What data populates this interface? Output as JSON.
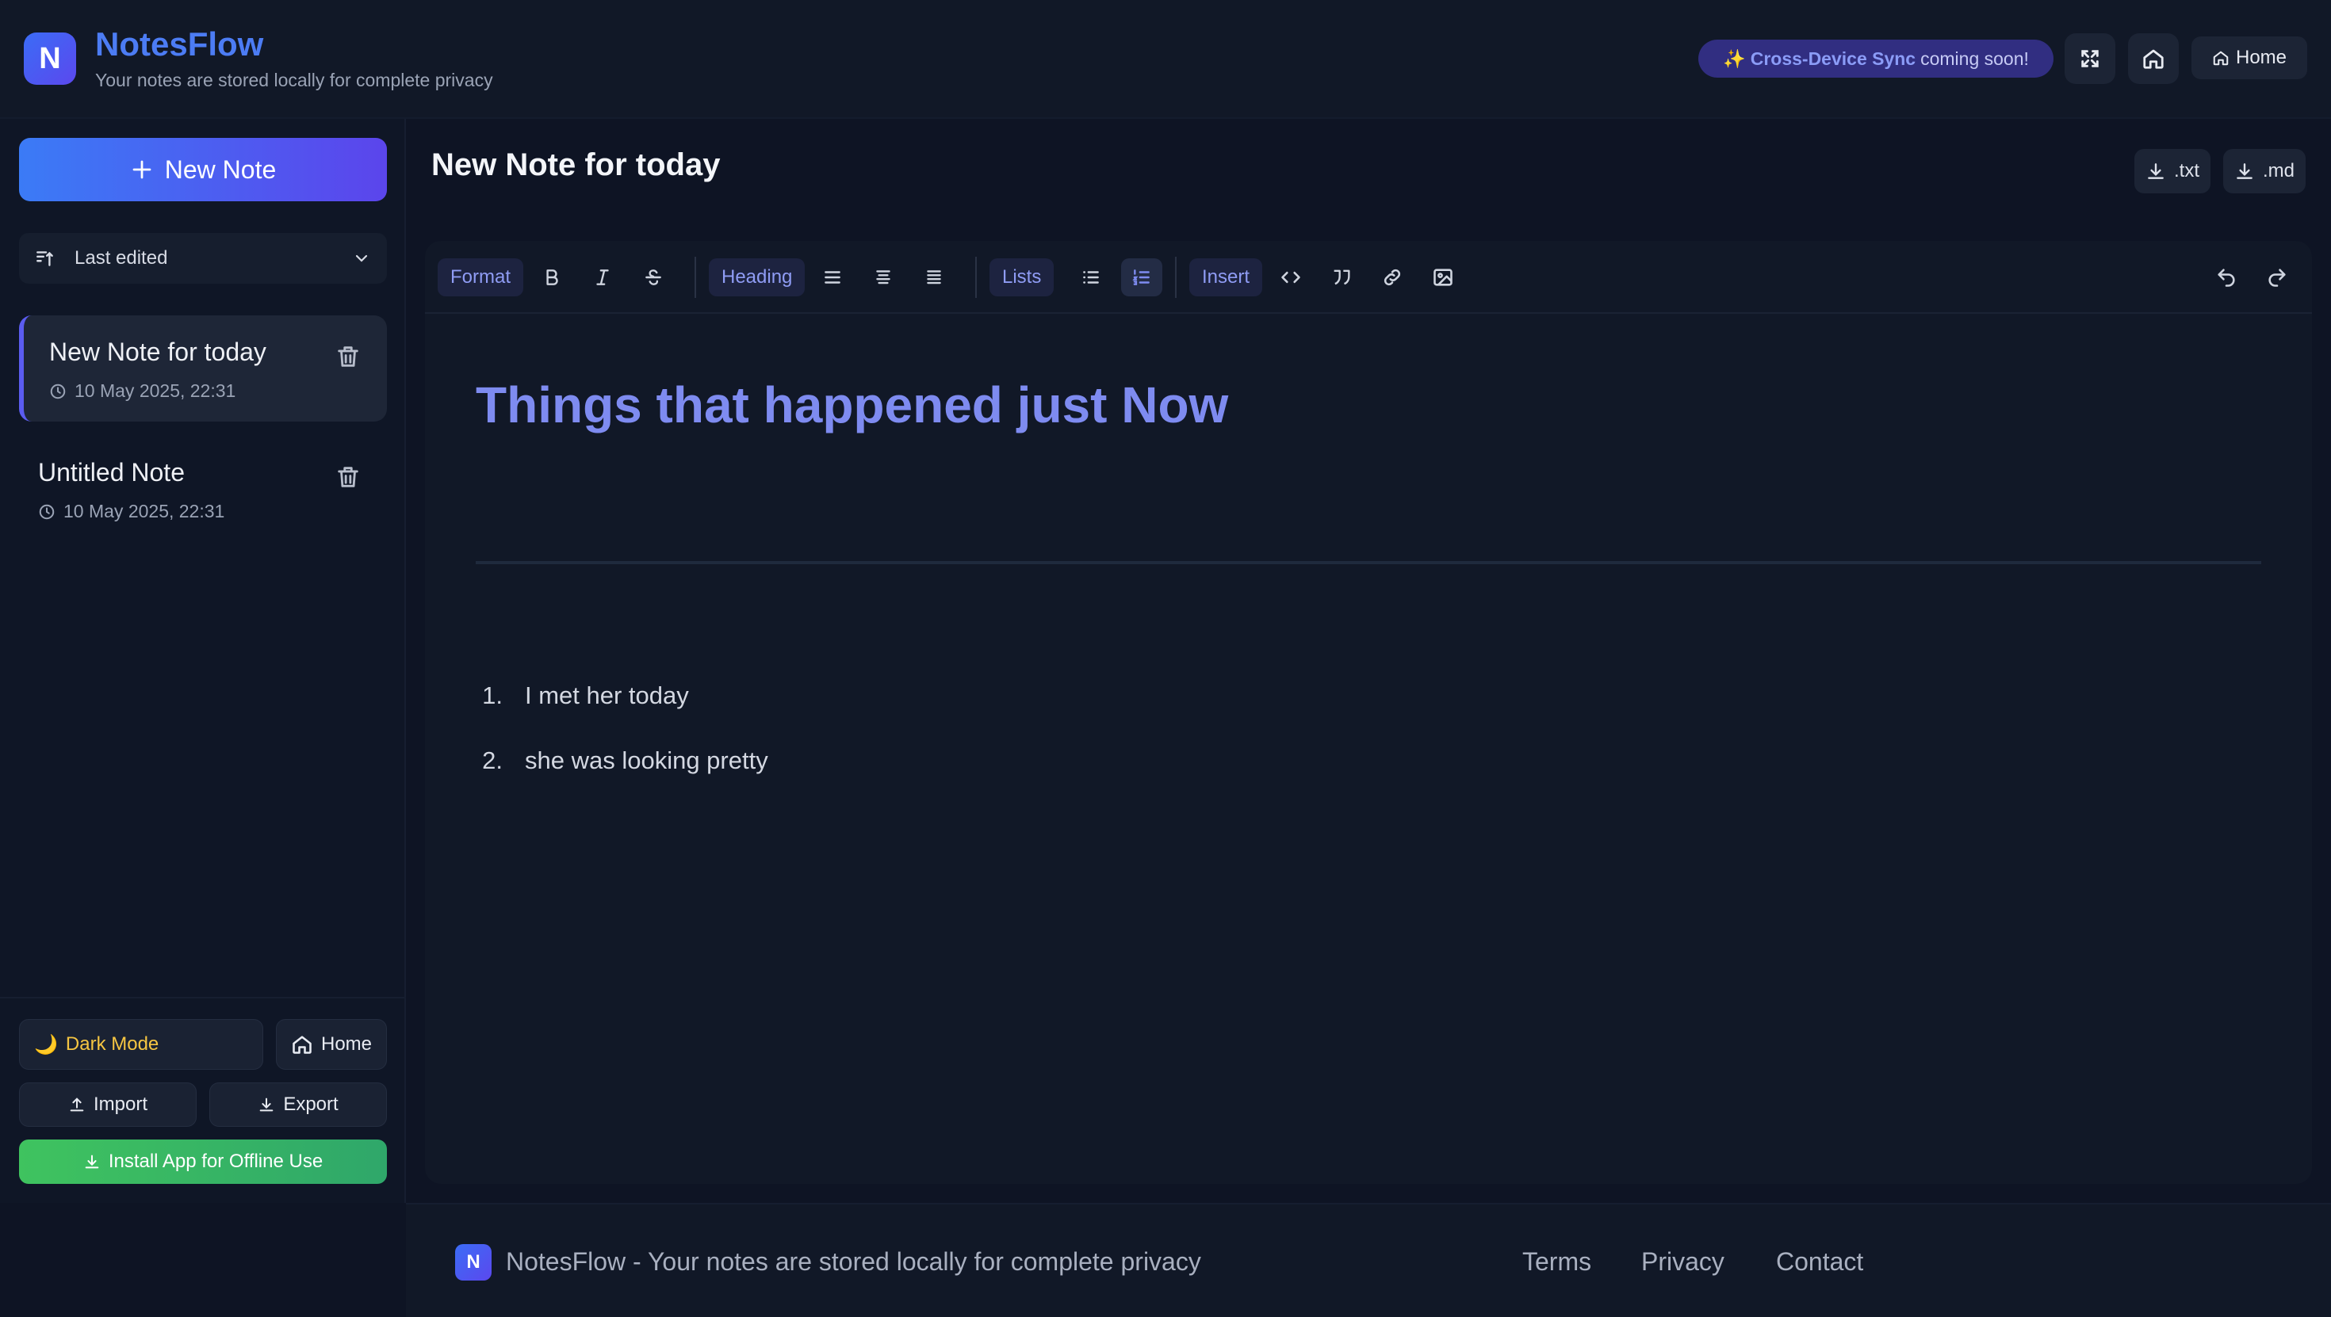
{
  "header": {
    "logo_letter": "N",
    "app_name": "NotesFlow",
    "tagline": "Your notes are stored locally for complete privacy",
    "sync_prefix": "✨",
    "sync_strong": "Cross-Device Sync",
    "sync_suffix": "coming soon!",
    "home_label": "Home"
  },
  "sidebar": {
    "new_note_label": "New Note",
    "sort_label": "Last edited",
    "notes": [
      {
        "title": "New Note for today",
        "timestamp": "10 May 2025, 22:31",
        "active": true
      },
      {
        "title": "Untitled Note",
        "timestamp": "10 May 2025, 22:31",
        "active": false
      }
    ],
    "dark_mode_label": "Dark Mode",
    "home_label": "Home",
    "import_label": "Import",
    "export_label": "Export",
    "install_label": "Install App for Offline Use"
  },
  "main": {
    "title": "New Note for today",
    "download_txt": ".txt",
    "download_md": ".md"
  },
  "toolbar": {
    "format_label": "Format",
    "heading_label": "Heading",
    "lists_label": "Lists",
    "insert_label": "Insert"
  },
  "document": {
    "heading": "Things that happened just Now",
    "list": [
      {
        "num": "1.",
        "text": "I met her today"
      },
      {
        "num": "2.",
        "text": "she was looking pretty"
      }
    ]
  },
  "footer": {
    "logo_letter": "N",
    "text": "NotesFlow - Your notes are stored locally for complete privacy",
    "links": [
      "Terms",
      "Privacy",
      "Contact"
    ]
  },
  "colors": {
    "accent": "#4c7cf4",
    "indigo": "#5b48ee",
    "heading": "#7e8bf0",
    "install_green": "#3fc35f",
    "dark_mode_yellow": "#f5c542"
  }
}
